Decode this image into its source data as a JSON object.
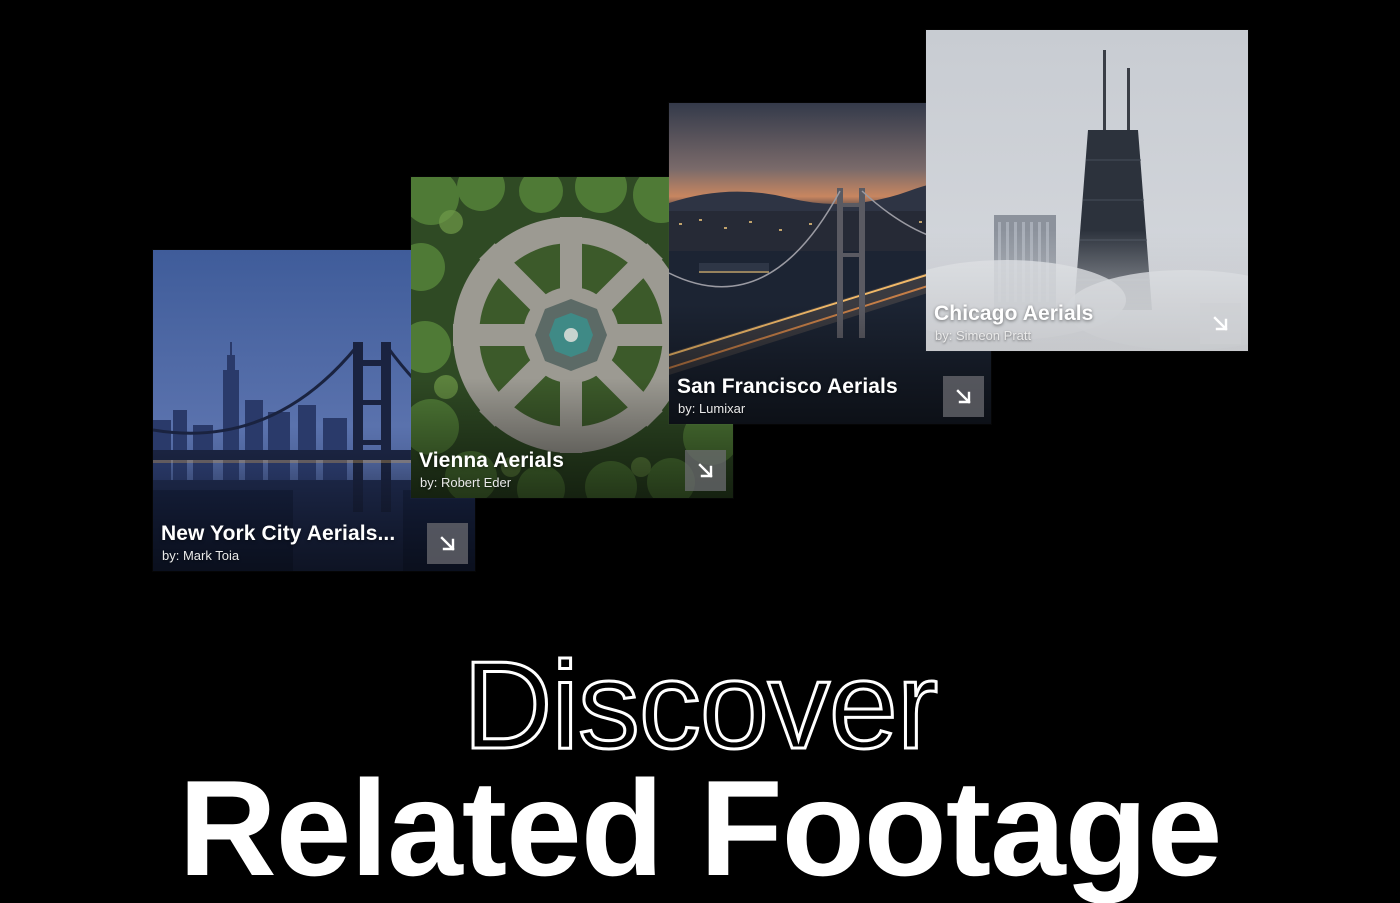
{
  "cards": [
    {
      "title": "New York City Aerials...",
      "author": "by: Mark Toia",
      "link_icon": "arrow-down-right-icon"
    },
    {
      "title": "Vienna Aerials",
      "author": "by: Robert Eder",
      "link_icon": "arrow-down-right-icon"
    },
    {
      "title": "San Francisco Aerials",
      "author": "by: Lumixar",
      "link_icon": "arrow-down-right-icon"
    },
    {
      "title": "Chicago Aerials",
      "author": "by: Simeon Pratt",
      "link_icon": "arrow-down-right-icon"
    }
  ],
  "heading": {
    "line1": "Discover",
    "line2": "Related Footage"
  },
  "colors": {
    "background": "#000000",
    "text": "#ffffff"
  }
}
